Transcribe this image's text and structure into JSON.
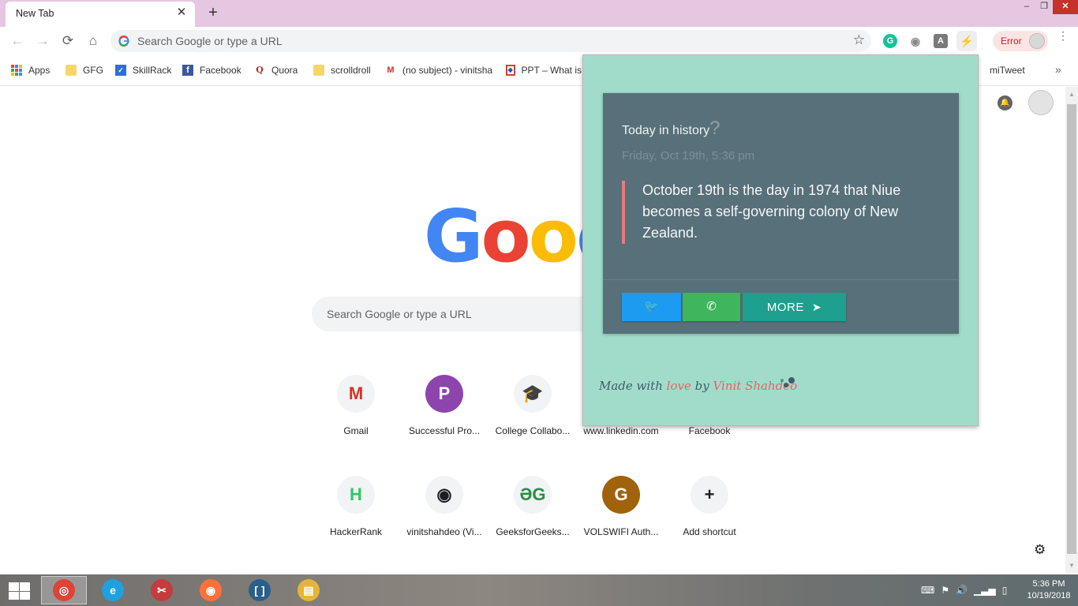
{
  "browser": {
    "tab_title": "New Tab",
    "tab_close": "✕",
    "new_tab": "+",
    "window_controls": {
      "minimize": "–",
      "restore": "❐",
      "close": "✕"
    },
    "nav": {
      "back": "←",
      "forward": "→",
      "reload": "⟳",
      "home": "⌂"
    },
    "omnibox_placeholder": "Search Google or type a URL",
    "star": "☆",
    "profile_status": "Error",
    "extensions": {
      "grammarly": "G",
      "eye": "◉",
      "a_icon": "A",
      "active_ext": "⚡"
    },
    "menu": "⋮"
  },
  "bookmarks": {
    "items": [
      {
        "label": "Apps",
        "icon": "apps-grid-icon"
      },
      {
        "label": "GFG",
        "icon": "folder-icon"
      },
      {
        "label": "SkillRack",
        "icon": "skillrack-icon"
      },
      {
        "label": "Facebook",
        "icon": "facebook-icon"
      },
      {
        "label": "Quora",
        "icon": "quora-icon"
      },
      {
        "label": "scrolldroll",
        "icon": "folder-icon"
      },
      {
        "label": "(no subject) - vinitsha",
        "icon": "gmail-icon"
      },
      {
        "label": "PPT – What is",
        "icon": "ppt-icon"
      },
      {
        "label": "miTweet",
        "icon": "folder-icon"
      }
    ],
    "more": "»"
  },
  "ntp": {
    "logo_letters": [
      "G",
      "o",
      "o",
      "g"
    ],
    "logo_colors": [
      "#4285f4",
      "#ea4335",
      "#fbbc05",
      "#4285f4"
    ],
    "search_placeholder": "Search Google or type a URL",
    "tiles": [
      {
        "label": "Gmail",
        "glyph": "M",
        "color": "#d93025",
        "bg": "#f1f3f4"
      },
      {
        "label": "Successful Pro...",
        "glyph": "P",
        "color": "#ffffff",
        "bg": "#8e44ad"
      },
      {
        "label": "College Collabo...",
        "glyph": "🎓",
        "color": "#e06d1a",
        "bg": "#f1f3f4"
      },
      {
        "label": "www.linkedin.com",
        "glyph": "",
        "color": "#0a66c2",
        "bg": "#f1f3f4"
      },
      {
        "label": "Facebook",
        "glyph": "",
        "color": "#1877f2",
        "bg": "#f1f3f4"
      },
      {
        "label": "HackerRank",
        "glyph": "H",
        "color": "#2ec866",
        "bg": "#f1f3f4"
      },
      {
        "label": "vinitshahdeo (Vi...",
        "glyph": "◉",
        "color": "#1b1f23",
        "bg": "#f1f3f4"
      },
      {
        "label": "GeeksforGeeks...",
        "glyph": "ƏG",
        "color": "#2f8d46",
        "bg": "#f1f3f4"
      },
      {
        "label": "VOLSWIFI Auth...",
        "glyph": "G",
        "color": "#ffffff",
        "bg": "#a0620a"
      },
      {
        "label": "Add shortcut",
        "glyph": "+",
        "color": "#202124",
        "bg": "#f1f3f4"
      }
    ],
    "settings_icon": "⚙",
    "bell_icon": "🔔"
  },
  "popup": {
    "title": "Today in history",
    "title_mark": "?",
    "date": "Friday, Oct 19th, 5:36 pm",
    "fact": "October 19th is the day in 1974 that Niue becomes a self-governing colony of New Zealand.",
    "buttons": {
      "twitter": "🐦",
      "whatsapp": "✆",
      "more": "MORE",
      "more_arrow": "➤"
    },
    "credit": {
      "prefix": "Made with ",
      "love": "love",
      "by": " by ",
      "author": "Vinit Shahdeo"
    },
    "colors": {
      "background": "#a1dcca",
      "card": "#587079",
      "accent": "#e87b7f"
    }
  },
  "taskbar": {
    "apps": [
      {
        "name": "Chrome",
        "glyph": "◎",
        "bg": "#db4437",
        "active": true
      },
      {
        "name": "Internet Explorer",
        "glyph": "e",
        "bg": "#1ea1e0",
        "active": false
      },
      {
        "name": "Snipping Tool",
        "glyph": "✂",
        "bg": "#c43c3c",
        "active": false
      },
      {
        "name": "Firefox",
        "glyph": "◉",
        "bg": "#ff7139",
        "active": false
      },
      {
        "name": "Brackets",
        "glyph": "[ ]",
        "bg": "#2a5f8a",
        "active": false
      },
      {
        "name": "File Explorer",
        "glyph": "▤",
        "bg": "#e5b53a",
        "active": false
      }
    ],
    "tray": [
      "⌨",
      "⚑",
      "🔊",
      "▁▃▅",
      "▯"
    ],
    "time": "5:36 PM",
    "date": "10/19/2018"
  }
}
